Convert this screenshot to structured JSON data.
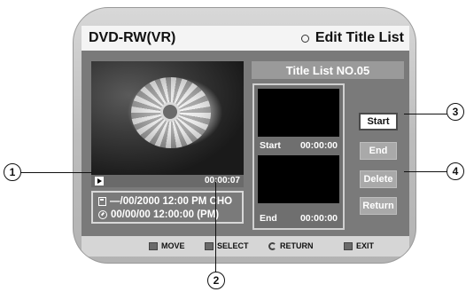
{
  "header": {
    "disc_type": "DVD-RW(VR)",
    "menu_title": "Edit Title List",
    "menu_icon": "ring-icon"
  },
  "preview": {
    "play_icon": "play-icon",
    "time": "00:00:07"
  },
  "info": {
    "title_line": "—/00/2000 12:00 PM CHO",
    "time_line": "00/00/00 12:00:00 (PM)",
    "disc_icon": "disc-icon",
    "clock_icon": "clock-icon"
  },
  "title_list": {
    "label": "Title List NO.05",
    "start_label": "Start",
    "start_time": "00:00:00",
    "end_label": "End",
    "end_time": "00:00:00"
  },
  "buttons": {
    "start": "Start",
    "end": "End",
    "delete": "Delete",
    "return": "Return"
  },
  "footer": {
    "move": "MOVE",
    "select": "SELECT",
    "return": "RETURN",
    "exit": "EXIT"
  },
  "callouts": {
    "c1": "1",
    "c2": "2",
    "c3": "3",
    "c4": "4"
  }
}
